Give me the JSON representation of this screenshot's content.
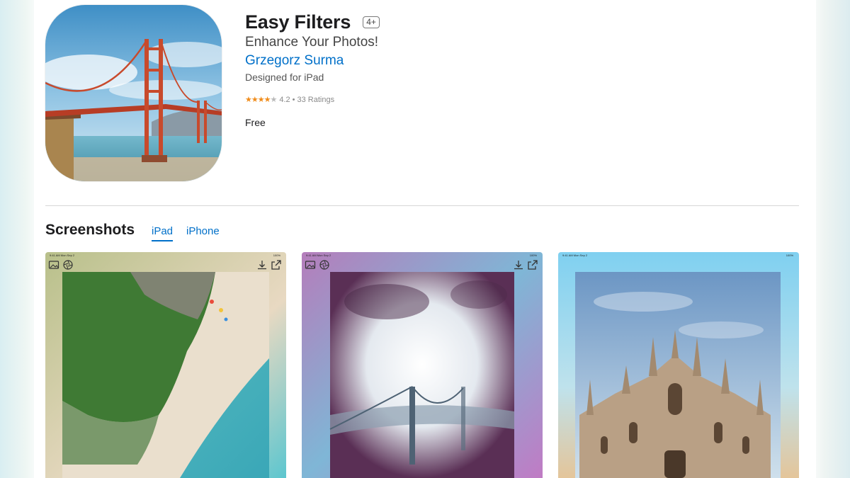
{
  "app": {
    "title": "Easy Filters",
    "age_rating": "4+",
    "subtitle": "Enhance Your Photos!",
    "developer": "Grzegorz Surma",
    "designed_for": "Designed for iPad",
    "rating_value": "4.2",
    "rating_separator": "•",
    "ratings_count": "33 Ratings",
    "stars_filled": 4.2,
    "stars_total": 5,
    "price": "Free",
    "icon_name": "golden-gate-bridge-app-icon"
  },
  "screenshots": {
    "heading": "Screenshots",
    "tabs": [
      {
        "label": "iPad",
        "selected": true
      },
      {
        "label": "iPhone",
        "selected": false
      }
    ],
    "items": [
      {
        "name": "aerial-beach-screenshot",
        "status_time": "9:41 AM  Mon Sep 2",
        "battery": "100%"
      },
      {
        "name": "foggy-bridge-screenshot",
        "status_time": "9:41 AM  Mon Sep 2",
        "battery": "100%"
      },
      {
        "name": "cathedral-screenshot",
        "status_time": "9:41 AM  Mon Sep 2",
        "battery": "100%"
      }
    ]
  },
  "colors": {
    "link": "#0070c9",
    "star": "#f08c1b",
    "text": "#1d1d1f"
  }
}
